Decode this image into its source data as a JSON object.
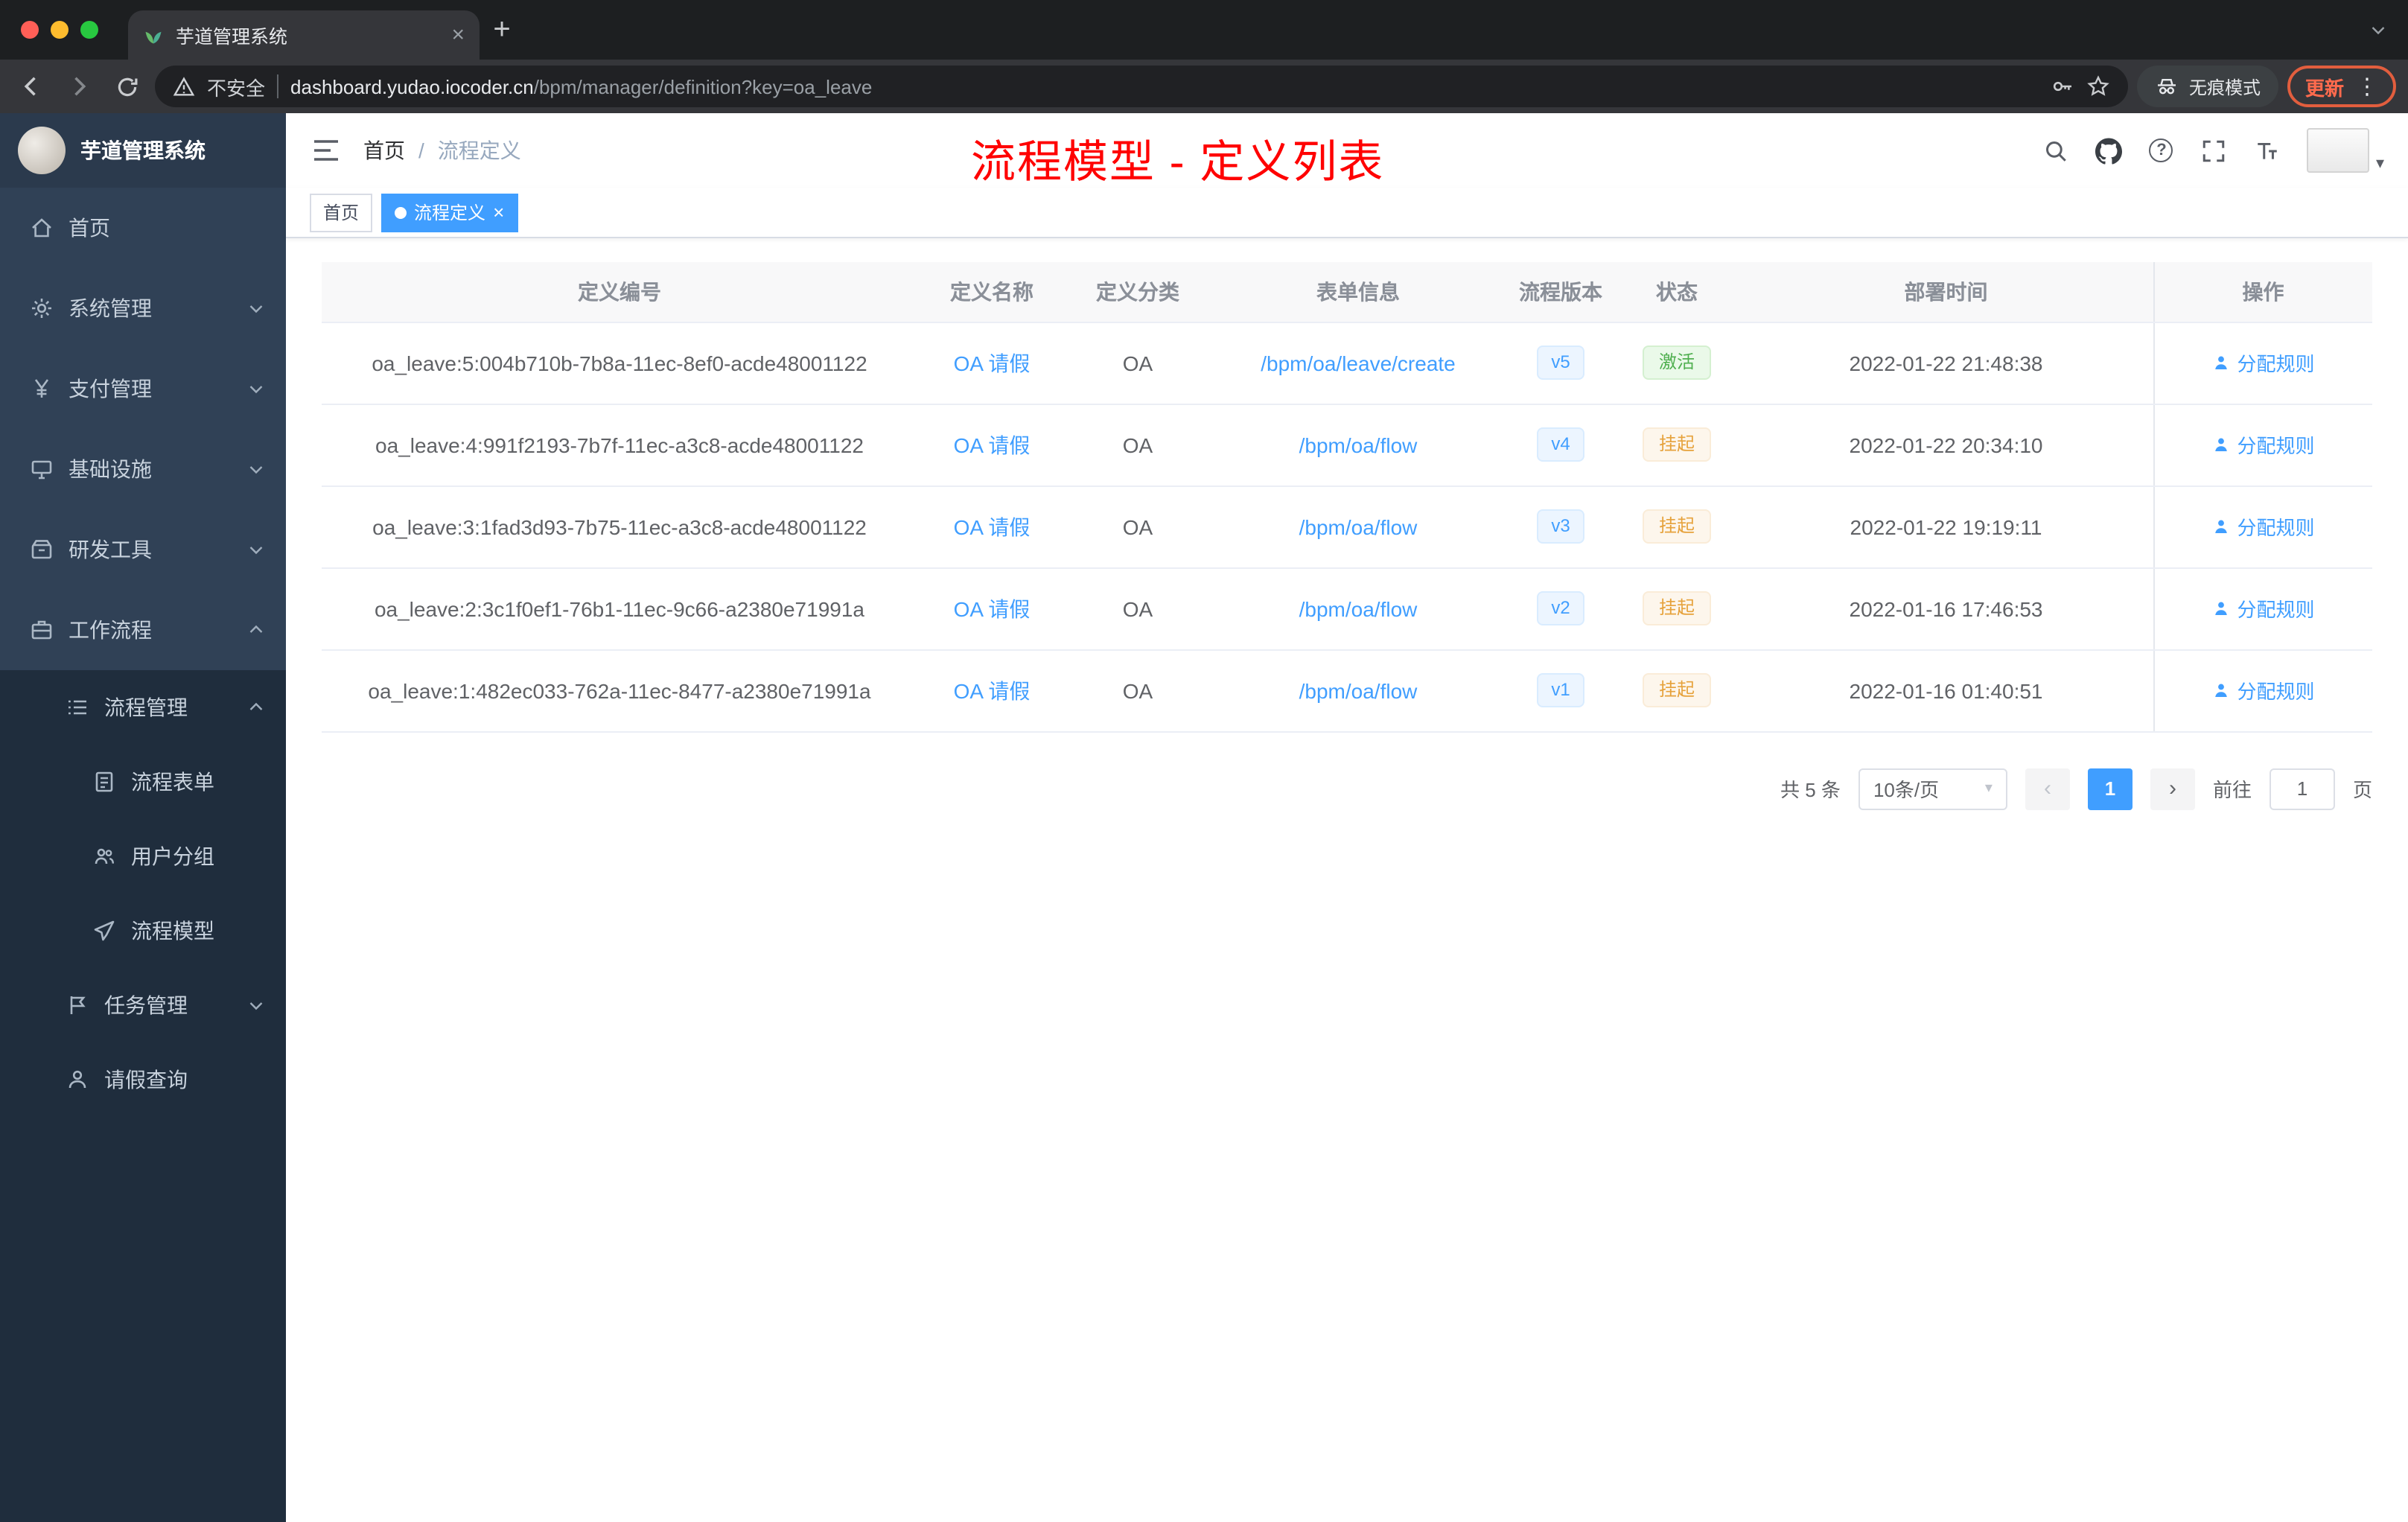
{
  "browser": {
    "tab_title": "芋道管理系统",
    "security_label": "不安全",
    "url_host": "dashboard.yudao.iocoder.cn",
    "url_path": "/bpm/manager/definition?key=oa_leave",
    "incognito_label": "无痕模式",
    "update_label": "更新"
  },
  "sidebar": {
    "logo": "芋道管理系统",
    "items": [
      {
        "label": "首页",
        "icon": "home-icon"
      },
      {
        "label": "系统管理",
        "icon": "gear-icon",
        "arrow": "down"
      },
      {
        "label": "支付管理",
        "icon": "yen-icon",
        "arrow": "down"
      },
      {
        "label": "基础设施",
        "icon": "monitor-icon",
        "arrow": "down"
      },
      {
        "label": "研发工具",
        "icon": "toolbox-icon",
        "arrow": "down"
      },
      {
        "label": "工作流程",
        "icon": "briefcase-icon",
        "arrow": "up"
      },
      {
        "label": "流程管理",
        "icon": "list-icon",
        "arrow": "up"
      },
      {
        "label": "流程表单",
        "icon": "document-icon"
      },
      {
        "label": "用户分组",
        "icon": "users-icon"
      },
      {
        "label": "流程模型",
        "icon": "paper-plane-icon"
      },
      {
        "label": "任务管理",
        "icon": "flag-icon",
        "arrow": "down"
      },
      {
        "label": "请假查询",
        "icon": "user-icon"
      }
    ]
  },
  "header": {
    "breadcrumb": [
      "首页",
      "流程定义"
    ],
    "separator": "/",
    "annotation": "流程模型 - 定义列表",
    "icons": [
      "search-icon",
      "github-icon",
      "help-icon",
      "fullscreen-icon",
      "font-size-icon",
      "avatar"
    ]
  },
  "tags": [
    {
      "label": "首页",
      "active": false
    },
    {
      "label": "流程定义",
      "active": true
    }
  ],
  "table": {
    "columns": [
      "定义编号",
      "定义名称",
      "定义分类",
      "表单信息",
      "流程版本",
      "状态",
      "部署时间",
      "操作"
    ],
    "rows": [
      {
        "id": "oa_leave:5:004b710b-7b8a-11ec-8ef0-acde48001122",
        "name": "OA 请假",
        "category": "OA",
        "form": "/bpm/oa/leave/create",
        "version": "v5",
        "status": "激活",
        "status_type": "success",
        "deploy_time": "2022-01-22 21:48:38",
        "action": "分配规则"
      },
      {
        "id": "oa_leave:4:991f2193-7b7f-11ec-a3c8-acde48001122",
        "name": "OA 请假",
        "category": "OA",
        "form": "/bpm/oa/flow",
        "version": "v4",
        "status": "挂起",
        "status_type": "warning",
        "deploy_time": "2022-01-22 20:34:10",
        "action": "分配规则"
      },
      {
        "id": "oa_leave:3:1fad3d93-7b75-11ec-a3c8-acde48001122",
        "name": "OA 请假",
        "category": "OA",
        "form": "/bpm/oa/flow",
        "version": "v3",
        "status": "挂起",
        "status_type": "warning",
        "deploy_time": "2022-01-22 19:19:11",
        "action": "分配规则"
      },
      {
        "id": "oa_leave:2:3c1f0ef1-76b1-11ec-9c66-a2380e71991a",
        "name": "OA 请假",
        "category": "OA",
        "form": "/bpm/oa/flow",
        "version": "v2",
        "status": "挂起",
        "status_type": "warning",
        "deploy_time": "2022-01-16 17:46:53",
        "action": "分配规则"
      },
      {
        "id": "oa_leave:1:482ec033-762a-11ec-8477-a2380e71991a",
        "name": "OA 请假",
        "category": "OA",
        "form": "/bpm/oa/flow",
        "version": "v1",
        "status": "挂起",
        "status_type": "warning",
        "deploy_time": "2022-01-16 01:40:51",
        "action": "分配规则"
      }
    ]
  },
  "pagination": {
    "total": "共 5 条",
    "page_size": "10条/页",
    "current_page": "1",
    "prev": "‹",
    "next": "›",
    "goto_label": "前往",
    "goto_value": "1",
    "page_label": "页"
  },
  "colors": {
    "accent": "#409EFF",
    "success": "#67C23A",
    "warning": "#E6A23C",
    "annotation_red": "#FF0000",
    "sidebar_bg": "#304156",
    "sidebar_sub_bg": "#1F2D3D"
  }
}
